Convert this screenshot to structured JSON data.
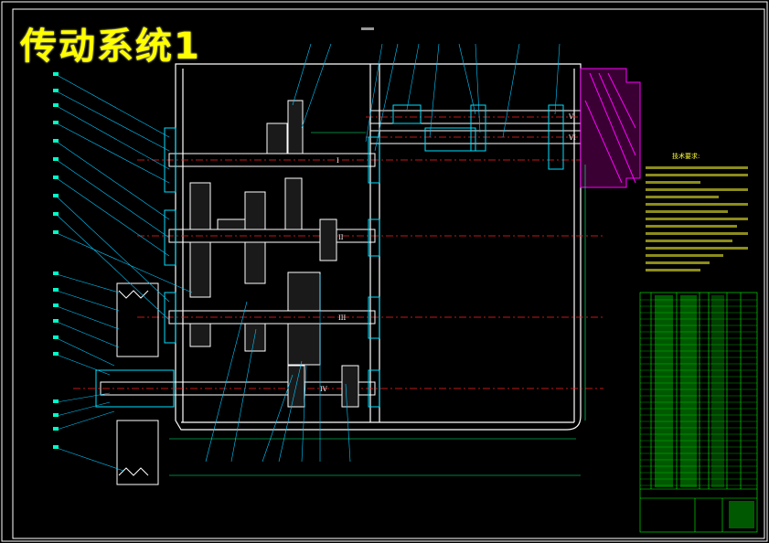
{
  "title": "传动系统1",
  "colors": {
    "background": "#000000",
    "frame": "#ffffff",
    "title": "#ffff00",
    "center_line": "#ff2020",
    "leader": "#00c8ff",
    "dimension": "#00ff80",
    "bearing": "#ff00ff",
    "notes": "#ffff33",
    "table": "#00ff00"
  },
  "shaft_labels": [
    "I",
    "II",
    "III",
    "IV",
    "V",
    "VI"
  ],
  "tech_notes_title": "技术要求:"
}
